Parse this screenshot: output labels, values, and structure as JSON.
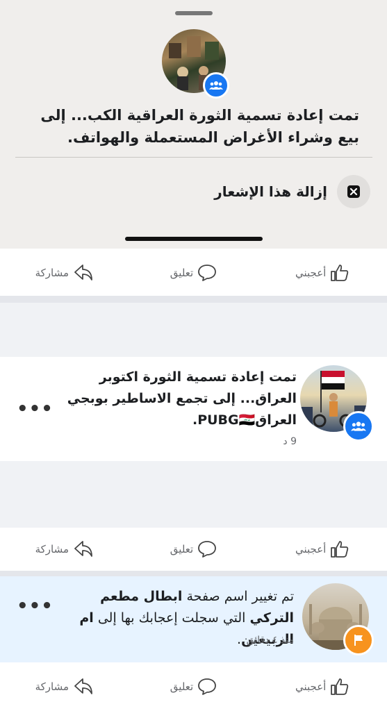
{
  "sheet": {
    "notification_text": "تمت إعادة تسمية الثورة العراقية الكب... إلى بيع وشراء الأغراض المستعملة والهواتف.",
    "remove_label": "إزالة هذا الإشعار"
  },
  "actions": {
    "like": "أعجبني",
    "comment": "تعليق",
    "share": "مشاركة"
  },
  "notifications": [
    {
      "text": "تمت إعادة تسمية الثورة اكتوبر العراق... إلى تجمع الاساطير بوبجي العراقPUBG🇮🇶.",
      "time": "9 د"
    },
    {
      "text_prefix": "تم تغيير اسم صفحة ",
      "page_name": "ابطال مطعم التركي",
      "text_mid": " التي سجلت إعجابك بها إلى ",
      "new_name": "ام الربيعين",
      "text_suffix": ".",
      "time": "منذ ٤ دقائق"
    }
  ],
  "colors": {
    "accent": "#1877f2",
    "sheet_bg": "#f0eeec",
    "unread_bg": "#e7f3ff",
    "page_badge": "#f7931e"
  }
}
